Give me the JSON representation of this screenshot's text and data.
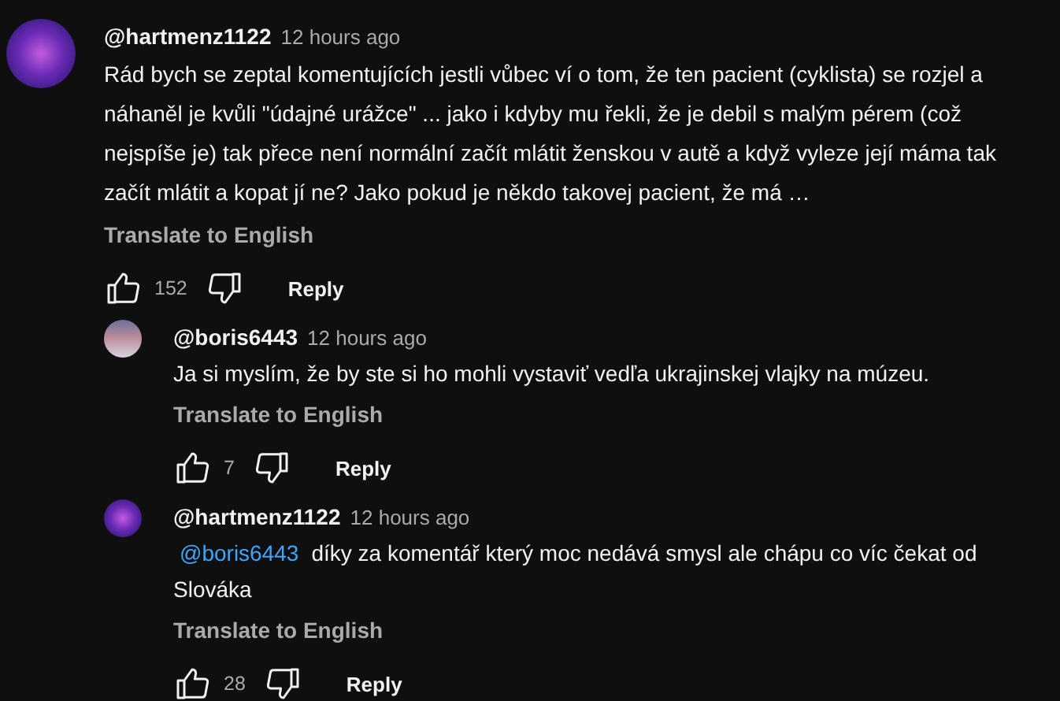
{
  "comment": {
    "author": "@hartmenz1122",
    "time": "12 hours ago",
    "body": "Rád bych se zeptal komentujících jestli vůbec ví o tom, že ten pacient (cyklista) se rozjel a náhaněl je kvůli \"údajné urážce\" ... jako i kdyby mu řekli, že je debil s malým pérem (což nejspíše je) tak přece není normální začít mlátit ženskou v autě a když vyleze její máma tak začít mlátit a kopat jí ne? Jako pokud je někdo takovej pacient, že má …",
    "translate": "Translate to English",
    "likes": "152",
    "reply": "Reply",
    "replies": [
      {
        "author": "@boris6443",
        "time": "12 hours ago",
        "body": "Ja si myslím, že by ste si ho mohli vystaviť vedľa ukrajinskej vlajky na múzeu.",
        "translate": "Translate to English",
        "likes": "7",
        "reply": "Reply"
      },
      {
        "author": "@hartmenz1122",
        "time": "12 hours ago",
        "mention": "@boris6443",
        "body": "díky za komentář který moc nedává smysl ale chápu co víc čekat od Slováka",
        "translate": "Translate to English",
        "likes": "28",
        "reply": "Reply"
      }
    ]
  }
}
